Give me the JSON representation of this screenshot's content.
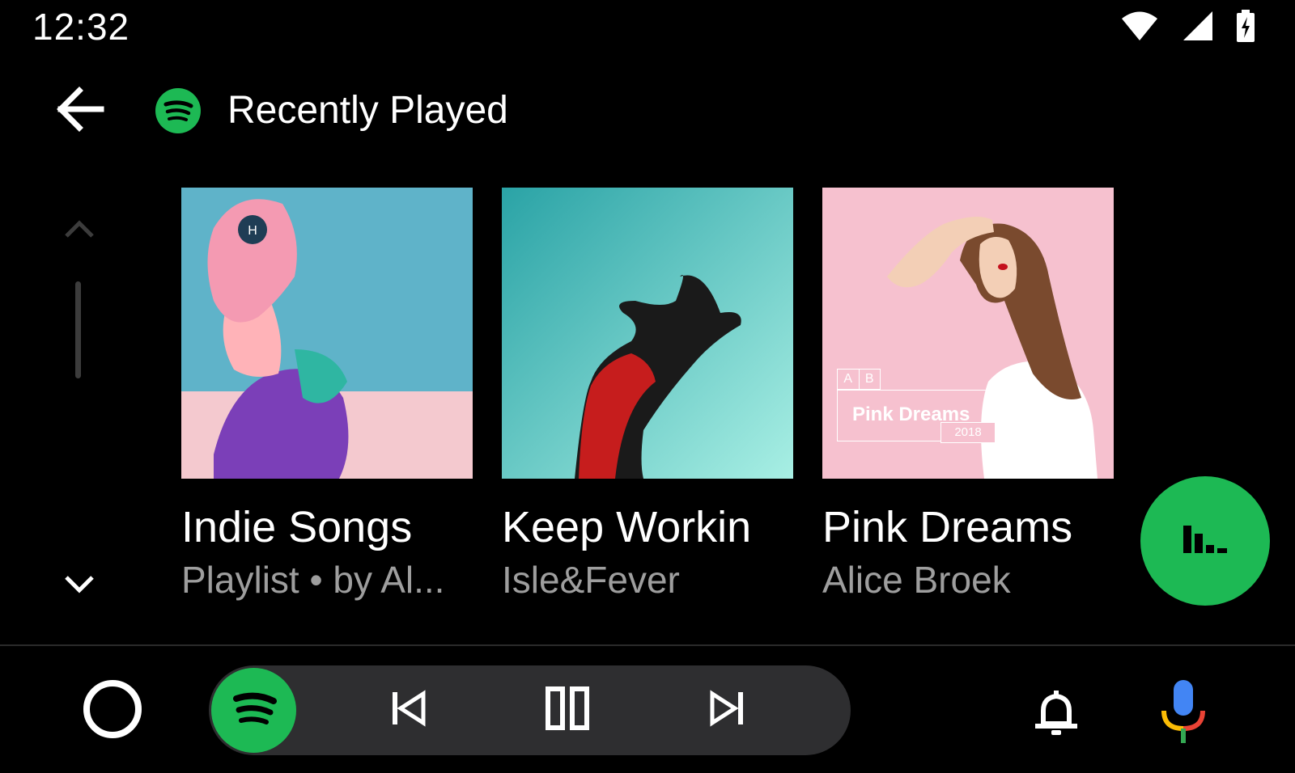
{
  "status_bar": {
    "time": "12:32",
    "icons": [
      "wifi-icon",
      "cell-signal-icon",
      "battery-charging-icon"
    ]
  },
  "header": {
    "back_icon": "arrow-back-icon",
    "app_icon": "spotify-logo-icon",
    "title": "Recently Played"
  },
  "scroller": {
    "up_icon": "chevron-up-icon",
    "down_icon": "chevron-down-icon"
  },
  "cards": [
    {
      "title": "Indie Songs",
      "subtitle": "Playlist • by Al..."
    },
    {
      "title": "Keep Workin",
      "subtitle": "Isle&Fever"
    },
    {
      "title": "Pink Dreams",
      "subtitle": "Alice Broek",
      "art_text": {
        "letters": [
          "A",
          "B"
        ],
        "name": "Pink Dreams",
        "year": "2018"
      }
    }
  ],
  "fab": {
    "icon": "now-playing-bars-icon"
  },
  "nav_bar": {
    "home_icon": "home-circle-icon",
    "media_app_icon": "spotify-logo-icon",
    "controls": [
      "skip-previous-icon",
      "pause-icon",
      "skip-next-icon"
    ],
    "notifications_icon": "bell-icon",
    "assistant_icon": "microphone-icon"
  },
  "colors": {
    "background": "#000000",
    "spotify_green": "#1db954",
    "secondary_text": "#9e9e9e",
    "pill": "#2e2e30"
  }
}
